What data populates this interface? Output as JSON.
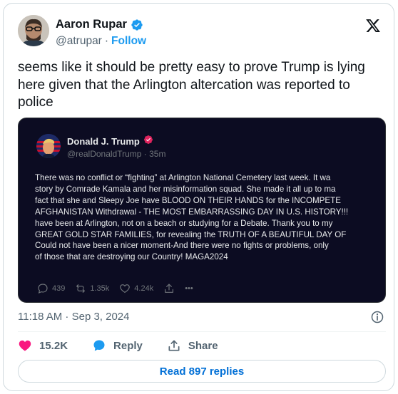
{
  "author": {
    "name": "Aaron Rupar",
    "handle": "@atrupar",
    "separator": "·",
    "follow_label": "Follow"
  },
  "tweet": {
    "text": "seems like it should be pretty easy to prove Trump is lying here given that the Arlington altercation was reported to police",
    "timestamp": "11:18 AM · Sep 3, 2024"
  },
  "embedded_post": {
    "name": "Donald J. Trump",
    "handle_time": "@realDonaldTrump · 35m",
    "body_lines": [
      "There was no conflict or “fighting” at Arlington National Cemetery last week. It wa",
      "story by Comrade Kamala and her misinformation squad. She made it all up to ma",
      "fact that she and Sleepy Joe have BLOOD ON THEIR HANDS for the INCOMPETE",
      "AFGHANISTAN Withdrawal - THE MOST EMBARRASSING DAY IN U.S. HISTORY!!!",
      "have been at Arlington, not on a beach or studying for a Debate. Thank you to my",
      "GREAT GOLD STAR FAMILIES, for revealing the TRUTH OF A BEAUTIFUL DAY OF",
      "Could not have been a nicer moment-And there were no fights or problems, only",
      "of those that are destroying our Country! MAGA2024"
    ],
    "reply_count": "439",
    "retruth_count": "1.35k",
    "like_count": "4.24k",
    "more_label": "•••"
  },
  "actions": {
    "like_count": "15.2K",
    "reply_label": "Reply",
    "share_label": "Share"
  },
  "read_replies_label": "Read 897 replies",
  "colors": {
    "accent": "#1d9bf0",
    "like": "#f91880",
    "link": "#006fd6",
    "embed_bg": "#0c0c22",
    "truth_badge": "#e0245e"
  }
}
